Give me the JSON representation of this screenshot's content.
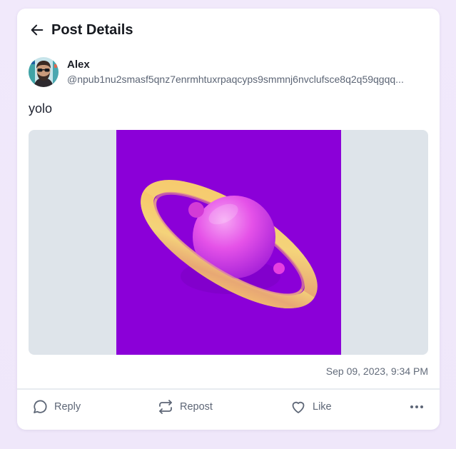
{
  "header": {
    "title": "Post Details"
  },
  "post": {
    "author_name": "Alex",
    "author_handle": "@npub1nu2smasf5qnz7enrmhtuxrpaqcyps9smmnj6nvclufsce8q2q59qgqq...",
    "content": "yolo",
    "timestamp": "Sep 09, 2023, 9:34 PM"
  },
  "actions": {
    "reply": "Reply",
    "repost": "Repost",
    "like": "Like"
  },
  "icons": {
    "back": "arrow-left-icon",
    "reply": "chat-bubble-icon",
    "repost": "repost-arrows-icon",
    "like": "heart-icon",
    "more": "more-horizontal-icon"
  },
  "colors": {
    "image_background": "#8b00d8",
    "media_letterbox": "#dee4ea",
    "ring": "#f6c776",
    "planet": "#e552e8"
  }
}
